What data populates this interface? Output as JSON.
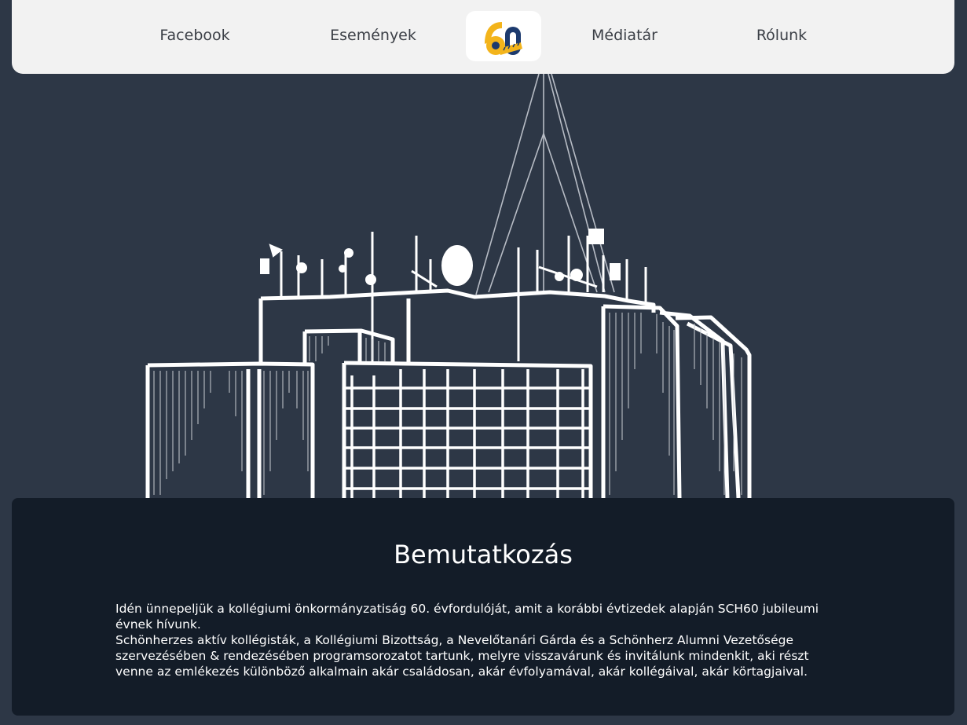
{
  "nav": {
    "items": [
      "Facebook",
      "Események",
      "Médiatár",
      "Rólunk"
    ],
    "logo_icon": "sch60-logo-icon",
    "logo_colors": {
      "gold": "#f3b41b",
      "navy": "#1c3a6e"
    }
  },
  "hero": {
    "illustration_icon": "schonherz-building-illustration"
  },
  "intro": {
    "title": "Bemutatkozás",
    "paragraphs": [
      "Idén ünnepeljük a kollégiumi önkormányzatiság 60. évfordulóját, amit a korábbi évtizedek alapján SCH60 jubileumi évnek hívunk.",
      "Schönherzes aktív kollégisták, a Kollégiumi Bizottság, a Nevelőtanári Gárda és a Schönherz Alumni Vezetősége szervezésében & rendezésében programsorozatot tartunk, melyre visszavárunk és invitálunk mindenkit, aki részt venne az emlékezés különböző alkalmain akár családosan, akár évfolyamával, akár kollégáival, akár körtagjaival."
    ]
  },
  "colors": {
    "page_bg": "#2d3746",
    "panel_bg": "#131c28",
    "nav_bg": "#f2f2f2"
  }
}
